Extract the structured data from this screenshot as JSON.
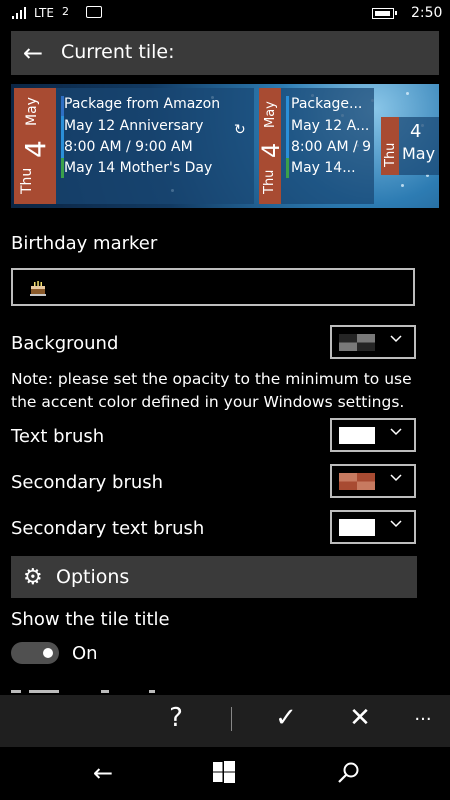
{
  "status": {
    "network": "LTE",
    "time": "2:50"
  },
  "header": {
    "title": "Current tile:"
  },
  "preview": {
    "big_tile": {
      "day_of_week": "Thu",
      "day": "4",
      "month": "May",
      "events": [
        "Package from Amazon",
        "May 12 Anniversary",
        "8:00 AM /  9:00 AM",
        "May 14 Mother's Day"
      ]
    },
    "mid_tile": {
      "day_of_week": "Thu",
      "day": "4",
      "month": "May",
      "events": [
        "Package...",
        "May 12 A...",
        "8:00 AM / 9",
        "May 14..."
      ]
    },
    "small_tile": {
      "day_of_week": "Thu",
      "day": "4",
      "month": "May"
    }
  },
  "birthday": {
    "label": "Birthday marker"
  },
  "background": {
    "label": "Background",
    "note": "Note: please set the opacity to the minimum to use the accent color defined in your Windows settings."
  },
  "text_brush": {
    "label": "Text brush"
  },
  "secondary_brush": {
    "label": "Secondary brush"
  },
  "secondary_text_brush": {
    "label": "Secondary text brush"
  },
  "options": {
    "label": "Options"
  },
  "tile_title": {
    "label": "Show the tile title",
    "state": "On"
  },
  "appbar": {
    "help": "?",
    "more": "···"
  },
  "colors": {
    "accent_red": "#a84b32",
    "panel": "#3a3a3a",
    "appbar": "#1f1f1f"
  }
}
